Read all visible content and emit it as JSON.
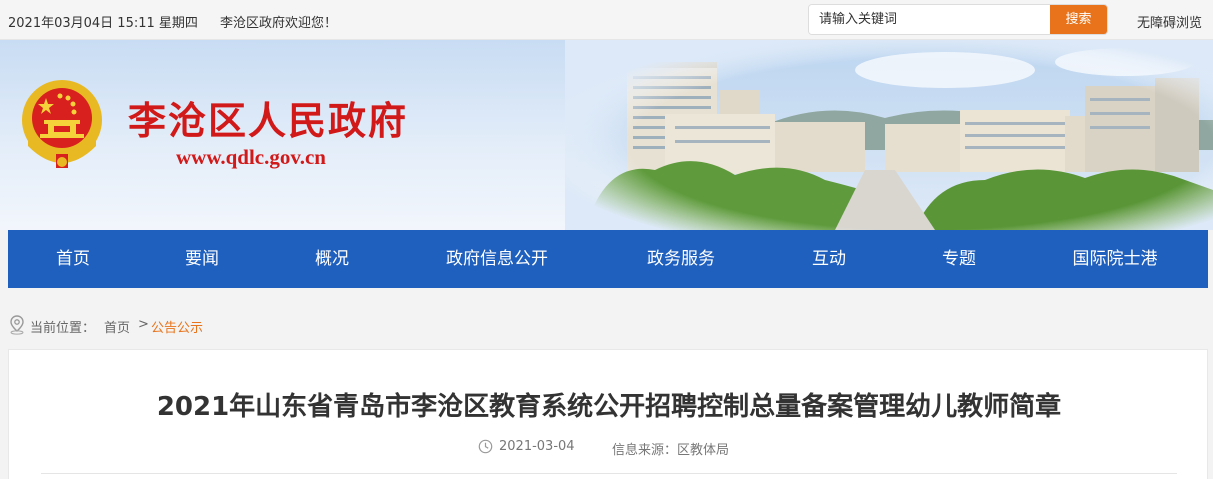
{
  "topbar": {
    "date": "2021年03月04日 15:11 星期四",
    "welcome": "李沧区政府欢迎您！",
    "search_placeholder": "请输入关键词",
    "search_button": "搜索",
    "accessibility": "无障碍浏览"
  },
  "banner": {
    "site_name": "李沧区人民政府",
    "site_url": "www.qdlc.gov.cn"
  },
  "nav": {
    "items": [
      "首页",
      "要闻",
      "概况",
      "政府信息公开",
      "政务服务",
      "互动",
      "专题",
      "国际院士港"
    ]
  },
  "breadcrumb": {
    "prefix": "当前位置：",
    "home": "首页",
    "separator": ">",
    "current": "公告公示"
  },
  "article": {
    "title": "2021年山东省青岛市李沧区教育系统公开招聘控制总量备案管理幼儿教师简章",
    "date": "2021-03-04",
    "source": "信息来源：区教体局"
  },
  "colors": {
    "nav_bg": "#1f5fbe",
    "accent_orange": "#e8731b",
    "title_red": "#d21919"
  }
}
